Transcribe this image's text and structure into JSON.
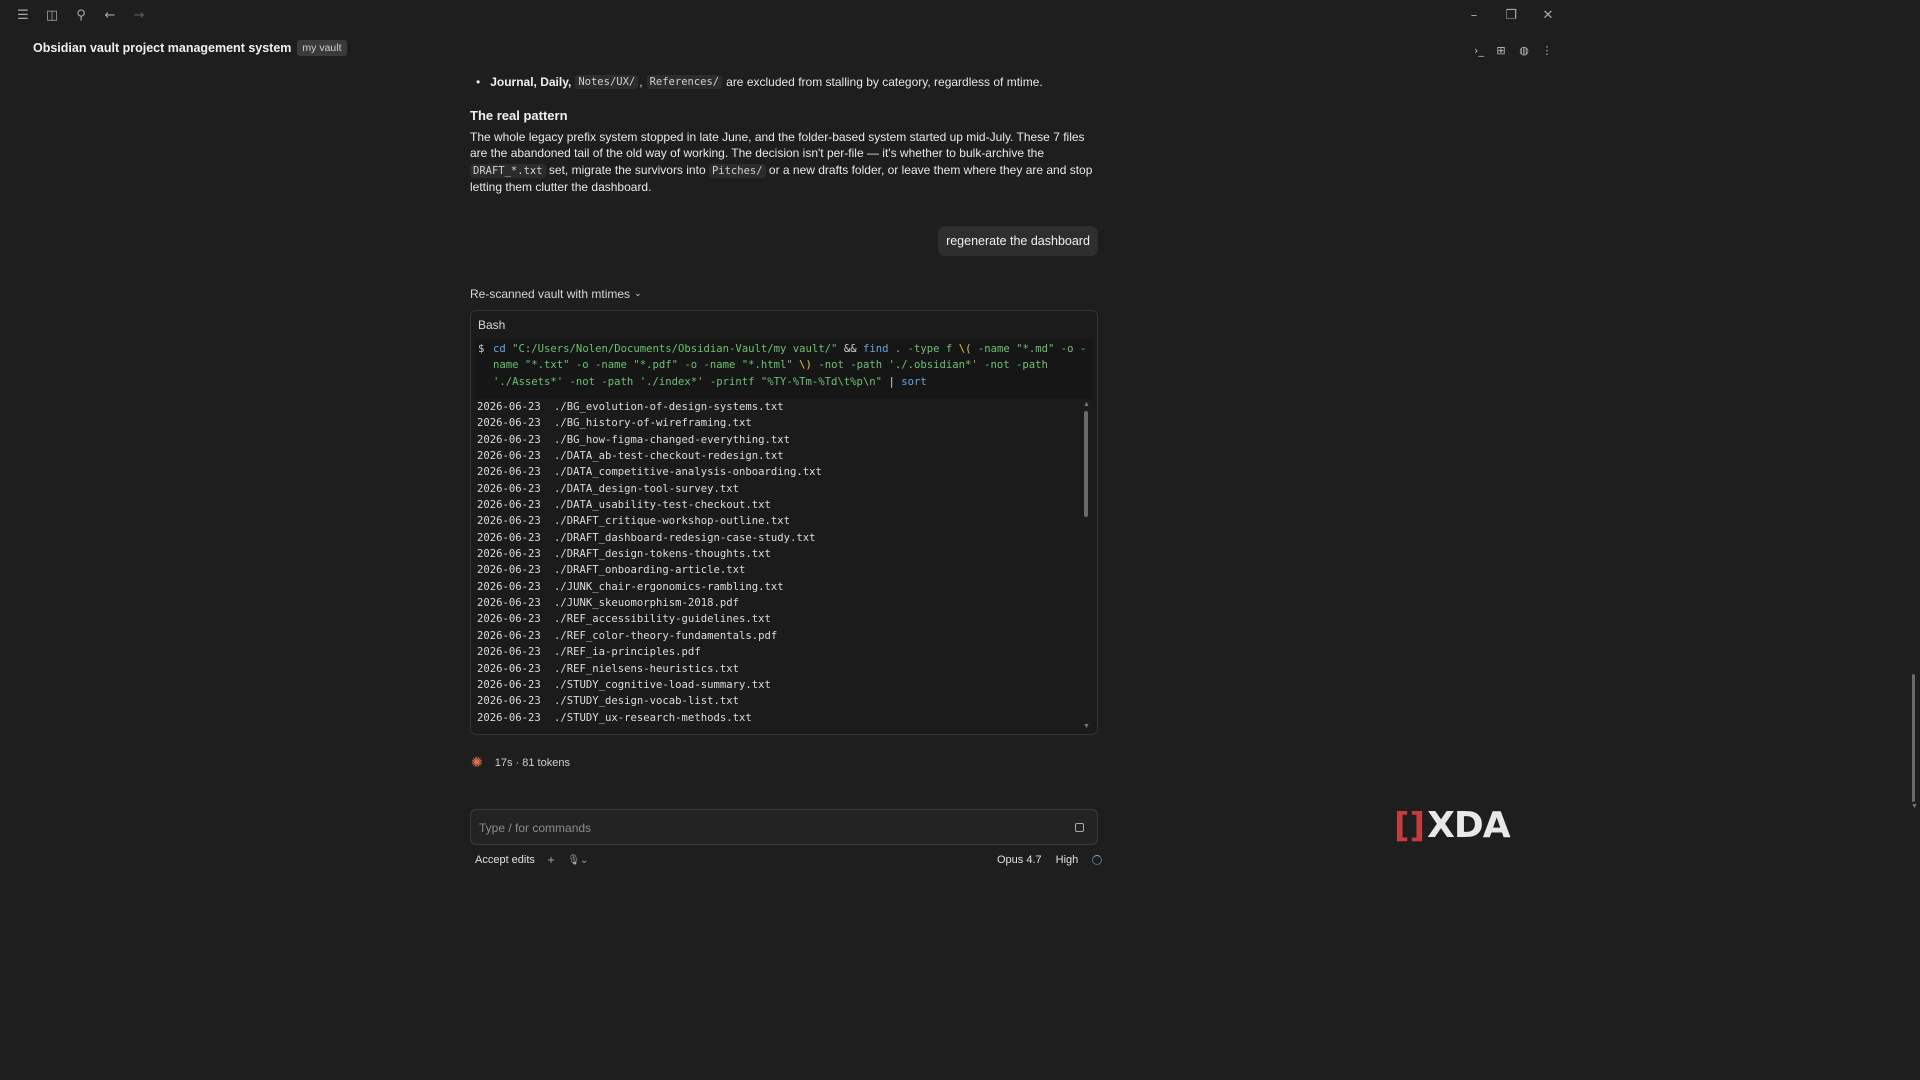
{
  "titlebar": {
    "icons": [
      "menu-icon",
      "sidebar-toggle-icon",
      "search-icon",
      "back-arrow-icon",
      "forward-arrow-icon"
    ],
    "window_controls": [
      "minimize-icon",
      "restore-icon",
      "close-icon"
    ]
  },
  "header": {
    "title": "Obsidian vault project management system",
    "badge": "my vault",
    "right_icons": [
      "terminal-icon",
      "panel-icon",
      "globe-icon",
      "more-icon"
    ]
  },
  "message": {
    "bullet_bold": "Journal, Daily,",
    "bullet_code_1": "Notes/UX/",
    "bullet_comma": ",",
    "bullet_code_2": "References/",
    "bullet_rest": "are excluded from stalling by category, regardless of mtime.",
    "heading": "The real pattern",
    "para_1": "The whole legacy prefix system stopped in late June, and the folder-based system started up mid-July. These 7 files are the abandoned tail of the old way of working. The decision isn't per-file — it's whether to bulk-archive the",
    "para_code_1": "DRAFT_*.txt",
    "para_2": "set, migrate the survivors into",
    "para_code_2": "Pitches/",
    "para_3": "or a new drafts folder, or leave them where they are and stop letting them clutter the dashboard."
  },
  "user_message": "regenerate the dashboard",
  "tool_call": {
    "summary": "Re-scanned vault with mtimes",
    "tool": "Bash",
    "prompt": "$",
    "command": {
      "cd": "cd",
      "path": "\"C:/Users/Nolen/Documents/Obsidian-Vault/my vault/\"",
      "and": "&&",
      "find": "find",
      "args1": ". -type f",
      "paren_open": "\\(",
      "args2": "-name \"*.md\" -o -",
      "line2": "name \"*.txt\" -o -name \"*.pdf\" -o -name \"*.html\"",
      "paren_close": "\\)",
      "line2_rest": "-not -path './.obsidian*' -not -path",
      "line3": "'./Assets*' -not -path './index*' -printf \"%TY-%Tm-%Td\\t%p\\n\"",
      "pipe": "|",
      "sort": "sort"
    },
    "output": [
      {
        "date": "2026-06-23",
        "path": "./BG_evolution-of-design-systems.txt"
      },
      {
        "date": "2026-06-23",
        "path": "./BG_history-of-wireframing.txt"
      },
      {
        "date": "2026-06-23",
        "path": "./BG_how-figma-changed-everything.txt"
      },
      {
        "date": "2026-06-23",
        "path": "./DATA_ab-test-checkout-redesign.txt"
      },
      {
        "date": "2026-06-23",
        "path": "./DATA_competitive-analysis-onboarding.txt"
      },
      {
        "date": "2026-06-23",
        "path": "./DATA_design-tool-survey.txt"
      },
      {
        "date": "2026-06-23",
        "path": "./DATA_usability-test-checkout.txt"
      },
      {
        "date": "2026-06-23",
        "path": "./DRAFT_critique-workshop-outline.txt"
      },
      {
        "date": "2026-06-23",
        "path": "./DRAFT_dashboard-redesign-case-study.txt"
      },
      {
        "date": "2026-06-23",
        "path": "./DRAFT_design-tokens-thoughts.txt"
      },
      {
        "date": "2026-06-23",
        "path": "./DRAFT_onboarding-article.txt"
      },
      {
        "date": "2026-06-23",
        "path": "./JUNK_chair-ergonomics-rambling.txt"
      },
      {
        "date": "2026-06-23",
        "path": "./JUNK_skeuomorphism-2018.pdf"
      },
      {
        "date": "2026-06-23",
        "path": "./REF_accessibility-guidelines.txt"
      },
      {
        "date": "2026-06-23",
        "path": "./REF_color-theory-fundamentals.pdf"
      },
      {
        "date": "2026-06-23",
        "path": "./REF_ia-principles.pdf"
      },
      {
        "date": "2026-06-23",
        "path": "./REF_nielsens-heuristics.txt"
      },
      {
        "date": "2026-06-23",
        "path": "./STUDY_cognitive-load-summary.txt"
      },
      {
        "date": "2026-06-23",
        "path": "./STUDY_design-vocab-list.txt"
      },
      {
        "date": "2026-06-23",
        "path": "./STUDY_ux-research-methods.txt"
      }
    ]
  },
  "stats": "17s · 81 tokens",
  "composer": {
    "placeholder": "Type / for commands",
    "accept_edits": "Accept edits",
    "plus": "+",
    "model": "Opus 4.7",
    "effort": "High"
  },
  "logo": {
    "mark": "[]",
    "text": "XDA"
  },
  "colors": {
    "background": "#1e1e1e",
    "accent_spark": "#e0714a",
    "logo_red": "#c43d3d"
  }
}
